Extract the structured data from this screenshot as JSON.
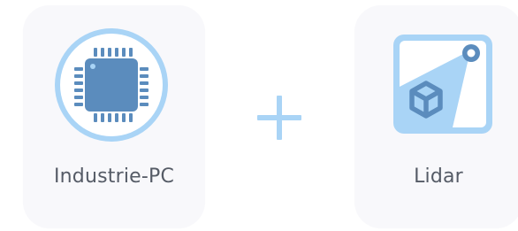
{
  "items": [
    {
      "label": "Industrie-PC",
      "icon": "cpu-chip-icon"
    },
    {
      "label": "Lidar",
      "icon": "lidar-sensor-icon"
    }
  ],
  "connector": {
    "icon": "plus-icon"
  },
  "colors": {
    "card_bg": "#f8f8fb",
    "icon_light": "#a9d4f6",
    "icon_dark": "#5b8cbd",
    "text": "#555b66"
  }
}
